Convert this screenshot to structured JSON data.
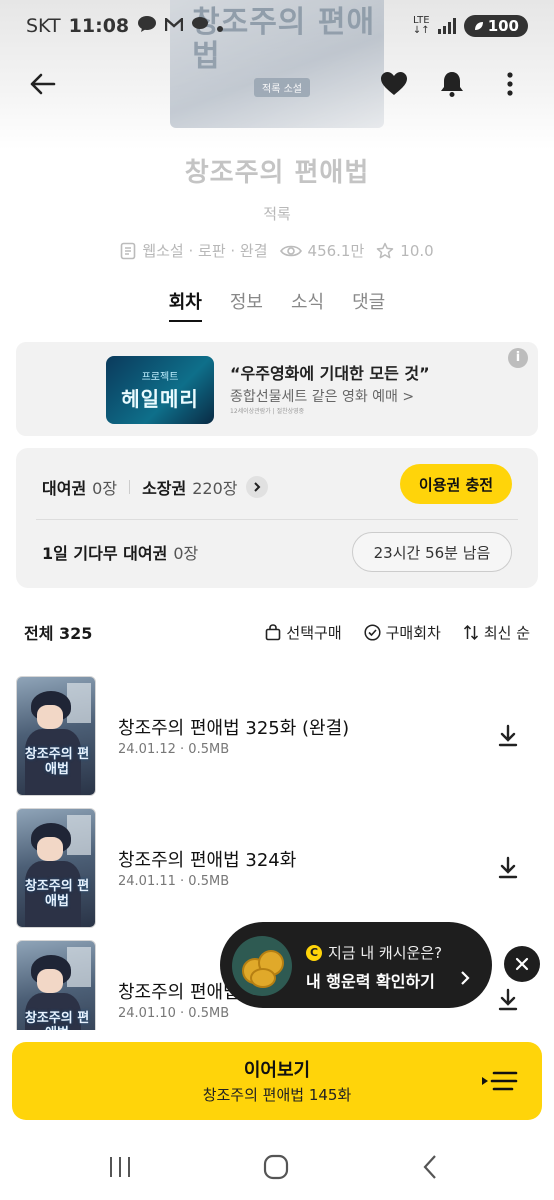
{
  "status_bar": {
    "carrier": "SKT",
    "time": "11:08",
    "network": "LTE",
    "battery": "100"
  },
  "cover": {
    "title_art": "창조주의 편애법",
    "badge": "적록 소설"
  },
  "book": {
    "title": "창조주의 편애법",
    "author": "적록",
    "category": "웹소설 · 로판 · 완결",
    "views": "456.1만",
    "rating": "10.0"
  },
  "tabs": [
    {
      "label": "회차",
      "active": true
    },
    {
      "label": "정보",
      "active": false
    },
    {
      "label": "소식",
      "active": false
    },
    {
      "label": "댓글",
      "active": false
    }
  ],
  "ad": {
    "thumb_small": "프로젝트",
    "thumb_large": "헤일메리",
    "title": "“우주영화에 기대한 모든 것”",
    "subtitle": "종합선물세트 같은 영화 예매 >",
    "fine_print": "12세이상관람가 | 절찬상영중",
    "info_icon": "i"
  },
  "tickets": {
    "rental_label": "대여권",
    "rental_value": "0장",
    "owned_label": "소장권",
    "owned_value": "220장",
    "charge_button": "이용권 충전",
    "wait_label": "1일 기다무 대여권",
    "wait_value": "0장",
    "wait_remaining": "23시간 56분 남음"
  },
  "list": {
    "total": "전체 325",
    "select_buy": "선택구매",
    "purchased": "구매회차",
    "sort": "최신 순"
  },
  "episodes": [
    {
      "title": "창조주의 편애법 325화 (완결)",
      "date": "24.01.12",
      "size": "0.5MB"
    },
    {
      "title": "창조주의 편애법 324화",
      "date": "24.01.11",
      "size": "0.5MB"
    },
    {
      "title": "창조주의 편애법 323화",
      "date": "24.01.10",
      "size": "0.5MB"
    }
  ],
  "episode_thumb_text": "창조주의 편애법",
  "continue": {
    "title": "이어보기",
    "subtitle": "창조주의 편애법 145화"
  },
  "toast": {
    "coin_letter": "C",
    "line1": "지금 내 캐시운은?",
    "line2": "내 행운력 확인하기"
  },
  "colors": {
    "accent": "#ffd40a",
    "dark": "#1e1e1e"
  }
}
